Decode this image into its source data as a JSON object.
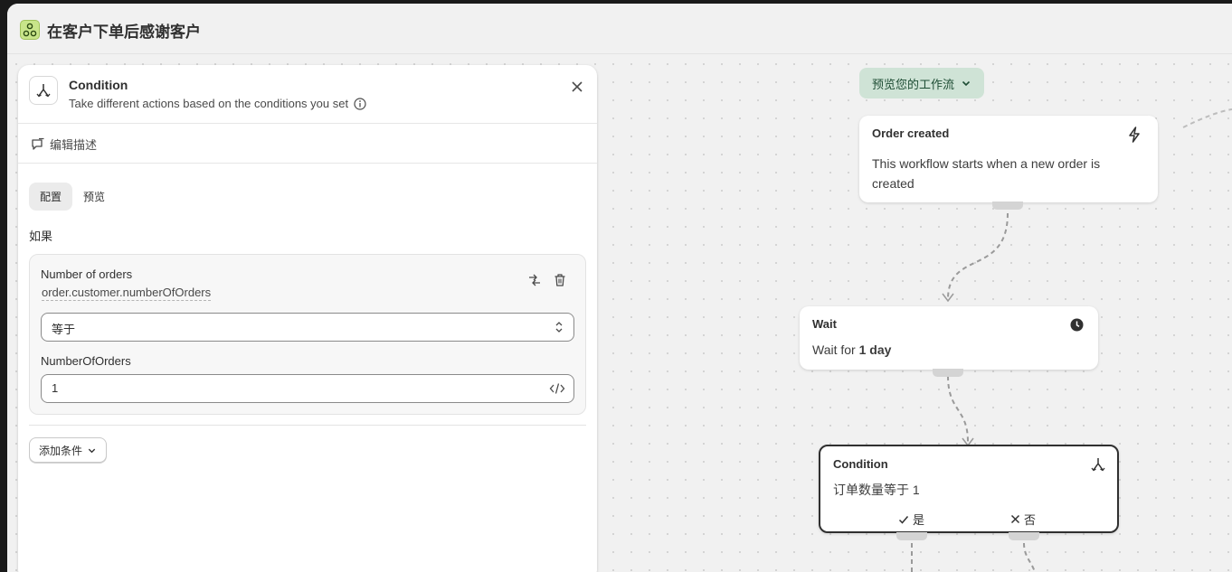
{
  "app": {
    "title": "在客户下单后感谢客户"
  },
  "panel": {
    "title": "Condition",
    "subtitle": "Take different actions based on the conditions you set",
    "edit_description": "编辑描述",
    "tabs": [
      {
        "label": "配置",
        "active": true
      },
      {
        "label": "预览",
        "active": false
      }
    ],
    "if_label": "如果",
    "condition": {
      "field_name": "Number of orders",
      "field_path": "order.customer.numberOfOrders",
      "operator": "等于",
      "value_label": "NumberOfOrders",
      "value": "1"
    },
    "add_condition": "添加条件"
  },
  "workflow": {
    "preview_button": "预览您的工作流",
    "nodes": {
      "trigger": {
        "title": "Order created",
        "body": "This workflow starts when a new order is created",
        "icon": "lightning-icon"
      },
      "wait": {
        "title": "Wait",
        "body_prefix": "Wait for ",
        "body_bold": "1 day",
        "icon": "clock-icon"
      },
      "condition": {
        "title": "Condition",
        "body": "订单数量等于 1",
        "icon": "branch-icon",
        "yes": "是",
        "no": "否"
      }
    }
  },
  "colors": {
    "preview_bg": "#cfe3d6",
    "preview_text": "#1e4d34",
    "app_icon": "#c8e58a"
  }
}
